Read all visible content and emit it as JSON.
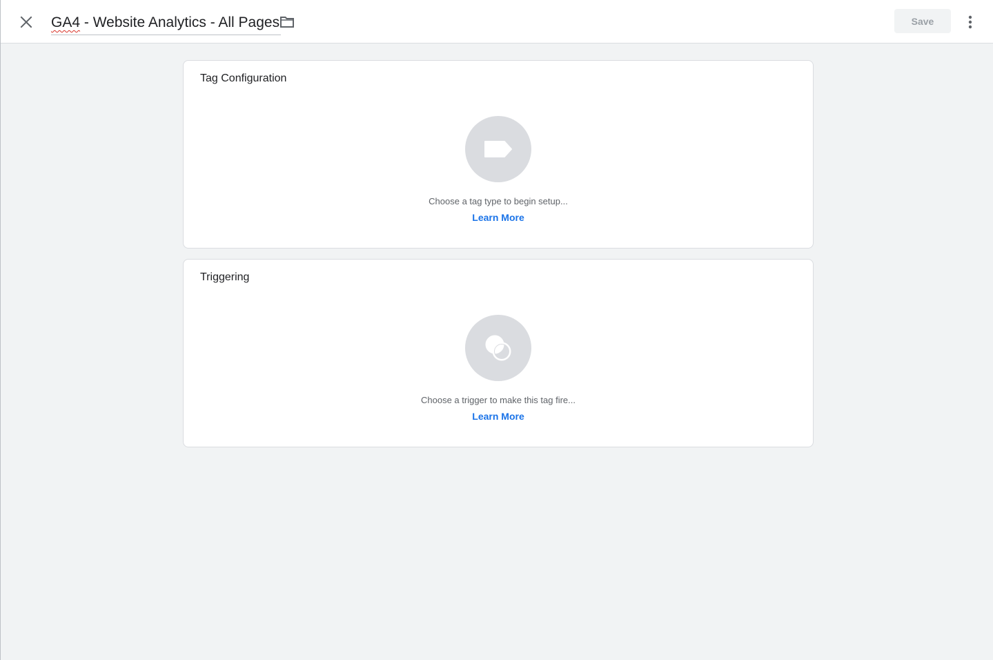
{
  "header": {
    "title_first_word": "GA4",
    "title_rest": " - Website Analytics - All Pages",
    "save_label": "Save"
  },
  "tag_configuration": {
    "title": "Tag Configuration",
    "hint": "Choose a tag type to begin setup...",
    "learn_more": "Learn More",
    "icon": "tag-icon"
  },
  "triggering": {
    "title": "Triggering",
    "hint": "Choose a trigger to make this tag fire...",
    "learn_more": "Learn More",
    "icon": "trigger-icon"
  },
  "colors": {
    "accent": "#1a73e8",
    "placeholder_circle": "#dadce0",
    "background": "#f1f3f4"
  }
}
